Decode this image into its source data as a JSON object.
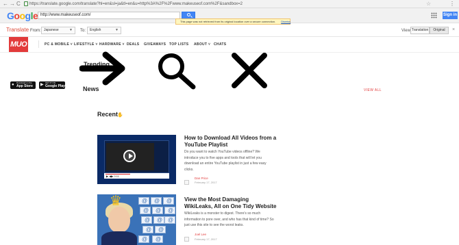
{
  "browser": {
    "url": "https://translate.google.com/translate?hl=en&sl=ja&tl=en&u=http%3A%2F%2Fwww.makeuseof.com%2F&sandbox=2",
    "back": "←",
    "forward": "→",
    "reload": "C"
  },
  "google": {
    "logo": [
      "G",
      "o",
      "o",
      "g",
      "l",
      "e"
    ],
    "search_value": "http://www.makeuseof.com/",
    "sign_in": "Sign in"
  },
  "translate_bar": {
    "title": "Translate",
    "from_label": "From:",
    "from_value": "Japanese",
    "to_label": "To:",
    "to_value": "English",
    "notice": "This page was not retrieved from its original location over a secure connection.",
    "dismiss": "Dismiss",
    "view_label": "View:",
    "translation": "Translation",
    "original": "Original"
  },
  "site": {
    "logo": "MUO",
    "nav": [
      {
        "label": "PC & MOBILE",
        "caret": "˅"
      },
      {
        "label": "LIFESTYLE",
        "caret": "˅"
      },
      {
        "label": "HARDWARE",
        "caret": "˅"
      },
      {
        "label": "DEALS",
        "caret": ""
      },
      {
        "label": "GIVEAWAYS",
        "caret": ""
      },
      {
        "label": "TOP LISTS",
        "caret": ""
      },
      {
        "label": "ABOUT",
        "caret": "˅"
      },
      {
        "label": "CHATS",
        "caret": ""
      }
    ],
    "badges": {
      "appstore_small": "Download on the",
      "appstore": "App Store",
      "googleplay_small": "GET IT ON",
      "googleplay": "Google Play"
    },
    "trending": "Trending",
    "news": "News",
    "view_all": "VIEW ALL",
    "recent": "Recent"
  },
  "overlay_icons": [
    "arrow-right-icon",
    "search-icon",
    "close-icon"
  ],
  "articles": [
    {
      "title": "How to Download All Videos from a YouTube Playlist",
      "excerpt": "Do you want to watch YouTube videos offline? We introduce you to five apps and tools that will let you download an entire YouTube playlist in just a few easy clicks.",
      "author": "Dan Price",
      "date": "February 17, 2017",
      "thumb_controls": "▶ ◀▶ 0:11"
    },
    {
      "title": "View the Most Damaging WikiLeaks, All on One Tidy Website",
      "excerpt": "WikiLeaks is a monster to digest. There's so much information to pore over, and who has that kind of time? So just use this site to see the worst leaks.",
      "author": "Joel Lee",
      "date": "February 17, 2017"
    }
  ],
  "colors": {
    "accent": "#e23b3b",
    "google_blue": "#4285f4",
    "notice_bg": "#fff6bf"
  }
}
